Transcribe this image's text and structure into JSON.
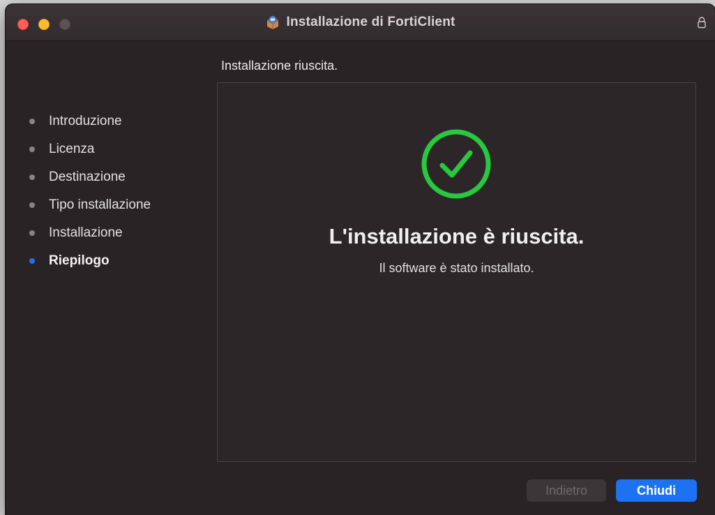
{
  "window": {
    "title": "Installazione di FortiClient"
  },
  "header": {
    "heading": "Installazione riuscita."
  },
  "sidebar": {
    "steps": [
      {
        "label": "Introduzione",
        "active": false
      },
      {
        "label": "Licenza",
        "active": false
      },
      {
        "label": "Destinazione",
        "active": false
      },
      {
        "label": "Tipo installazione",
        "active": false
      },
      {
        "label": "Installazione",
        "active": false
      },
      {
        "label": "Riepilogo",
        "active": true
      }
    ]
  },
  "main": {
    "status_icon": "checkmark-circle-icon",
    "title": "L'installazione è riuscita.",
    "subtitle": "Il software è stato installato."
  },
  "buttons": {
    "back_label": "Indietro",
    "back_enabled": false,
    "close_label": "Chiudi"
  },
  "colors": {
    "accent": "#1d72f2",
    "success": "#27c93f",
    "background": "#2a2326"
  },
  "icons": {
    "app": "installer-package-icon",
    "lock": "lock-icon"
  }
}
